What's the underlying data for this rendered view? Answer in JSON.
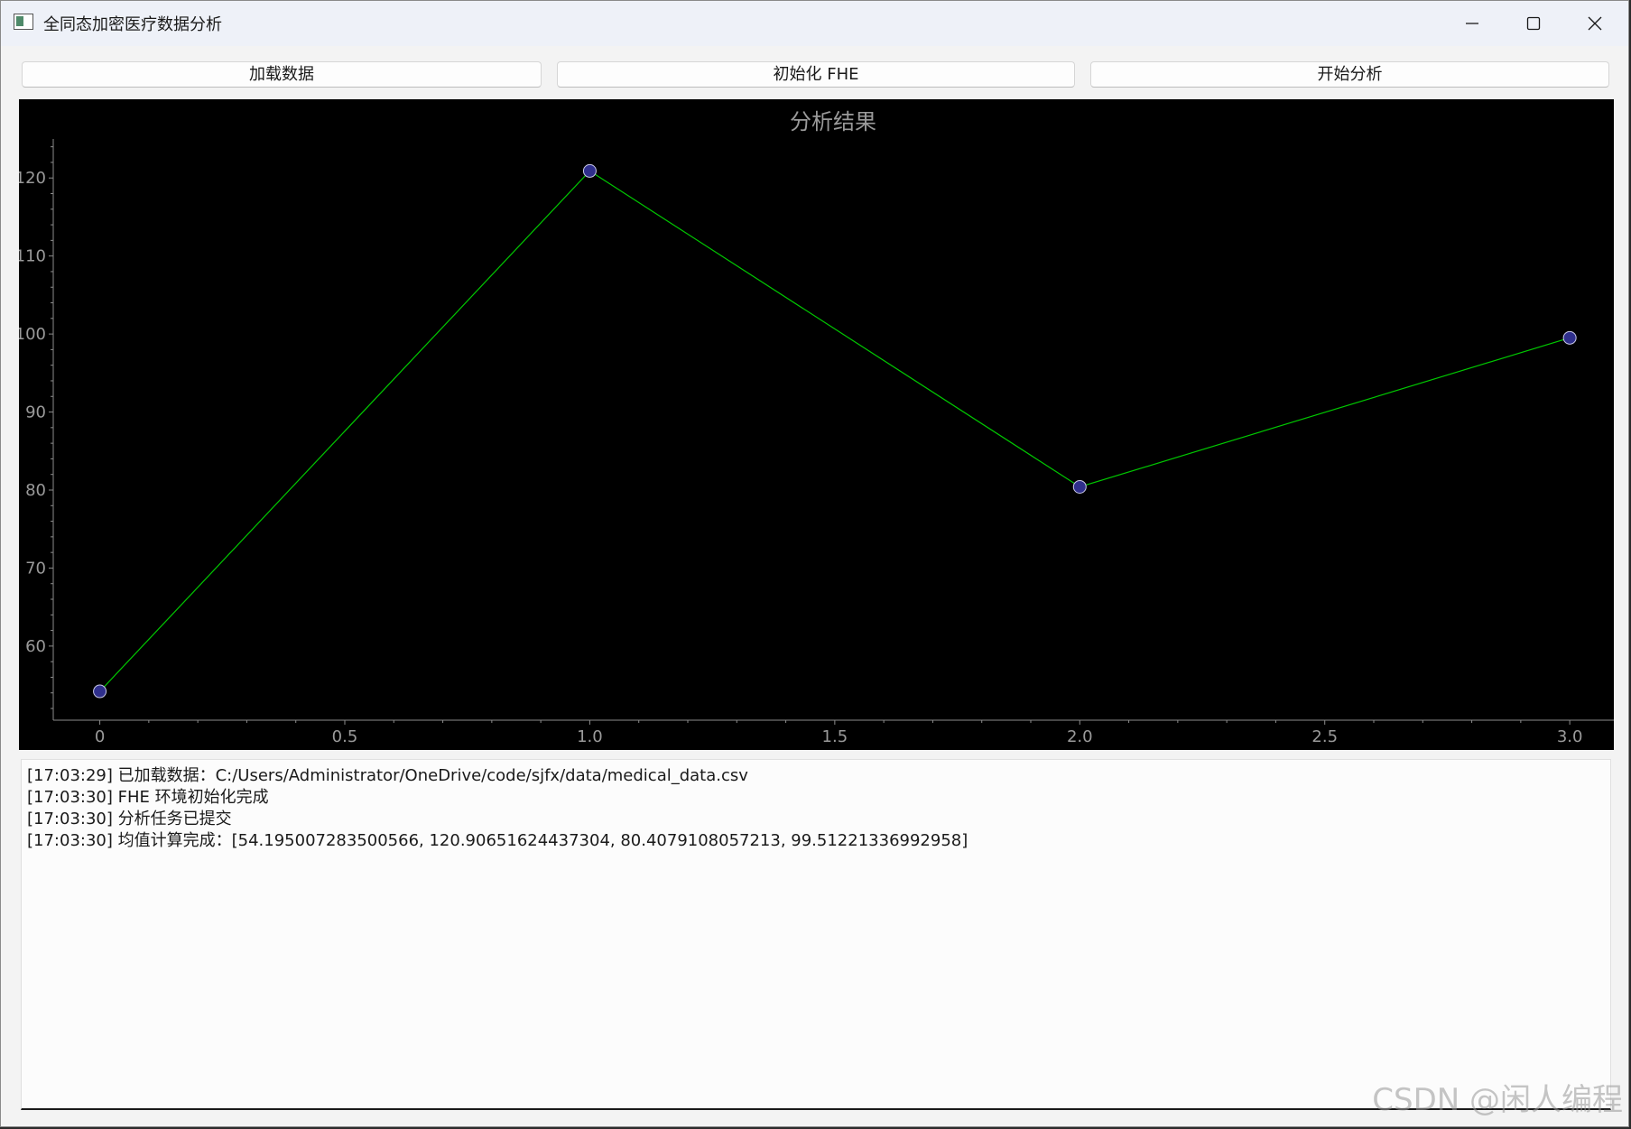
{
  "window": {
    "title": "全同态加密医疗数据分析"
  },
  "toolbar": {
    "load_label": "加载数据",
    "init_label": "初始化 FHE",
    "analyze_label": "开始分析"
  },
  "chart_data": {
    "type": "line",
    "title": "分析结果",
    "x": [
      0,
      1.0,
      2.0,
      3.0
    ],
    "y": [
      54.195007283500566,
      120.90651624437304,
      80.4079108057213,
      99.51221336992958
    ],
    "x_ticks": [
      "0",
      "0.5",
      "1.0",
      "1.5",
      "2.0",
      "2.5",
      "3.0"
    ],
    "x_tick_values": [
      0,
      0.5,
      1.0,
      1.5,
      2.0,
      2.5,
      3.0
    ],
    "y_ticks": [
      "60",
      "70",
      "80",
      "90",
      "100",
      "110",
      "120"
    ],
    "y_tick_values": [
      60,
      70,
      80,
      90,
      100,
      110,
      120
    ],
    "xlim": [
      -0.095,
      3.09
    ],
    "ylim": [
      50.5,
      125.0
    ],
    "grid": false,
    "line_color": "#00c800",
    "marker_color": "#2f2f8c",
    "background": "#000000"
  },
  "log": {
    "lines": [
      "[17:03:29] 已加载数据：C:/Users/Administrator/OneDrive/code/sjfx/data/medical_data.csv",
      "[17:03:30] FHE 环境初始化完成",
      "[17:03:30] 分析任务已提交",
      "[17:03:30] 均值计算完成：[54.195007283500566, 120.90651624437304, 80.4079108057213, 99.51221336992958]"
    ]
  },
  "watermark": {
    "text": "CSDN @闲人编程"
  }
}
